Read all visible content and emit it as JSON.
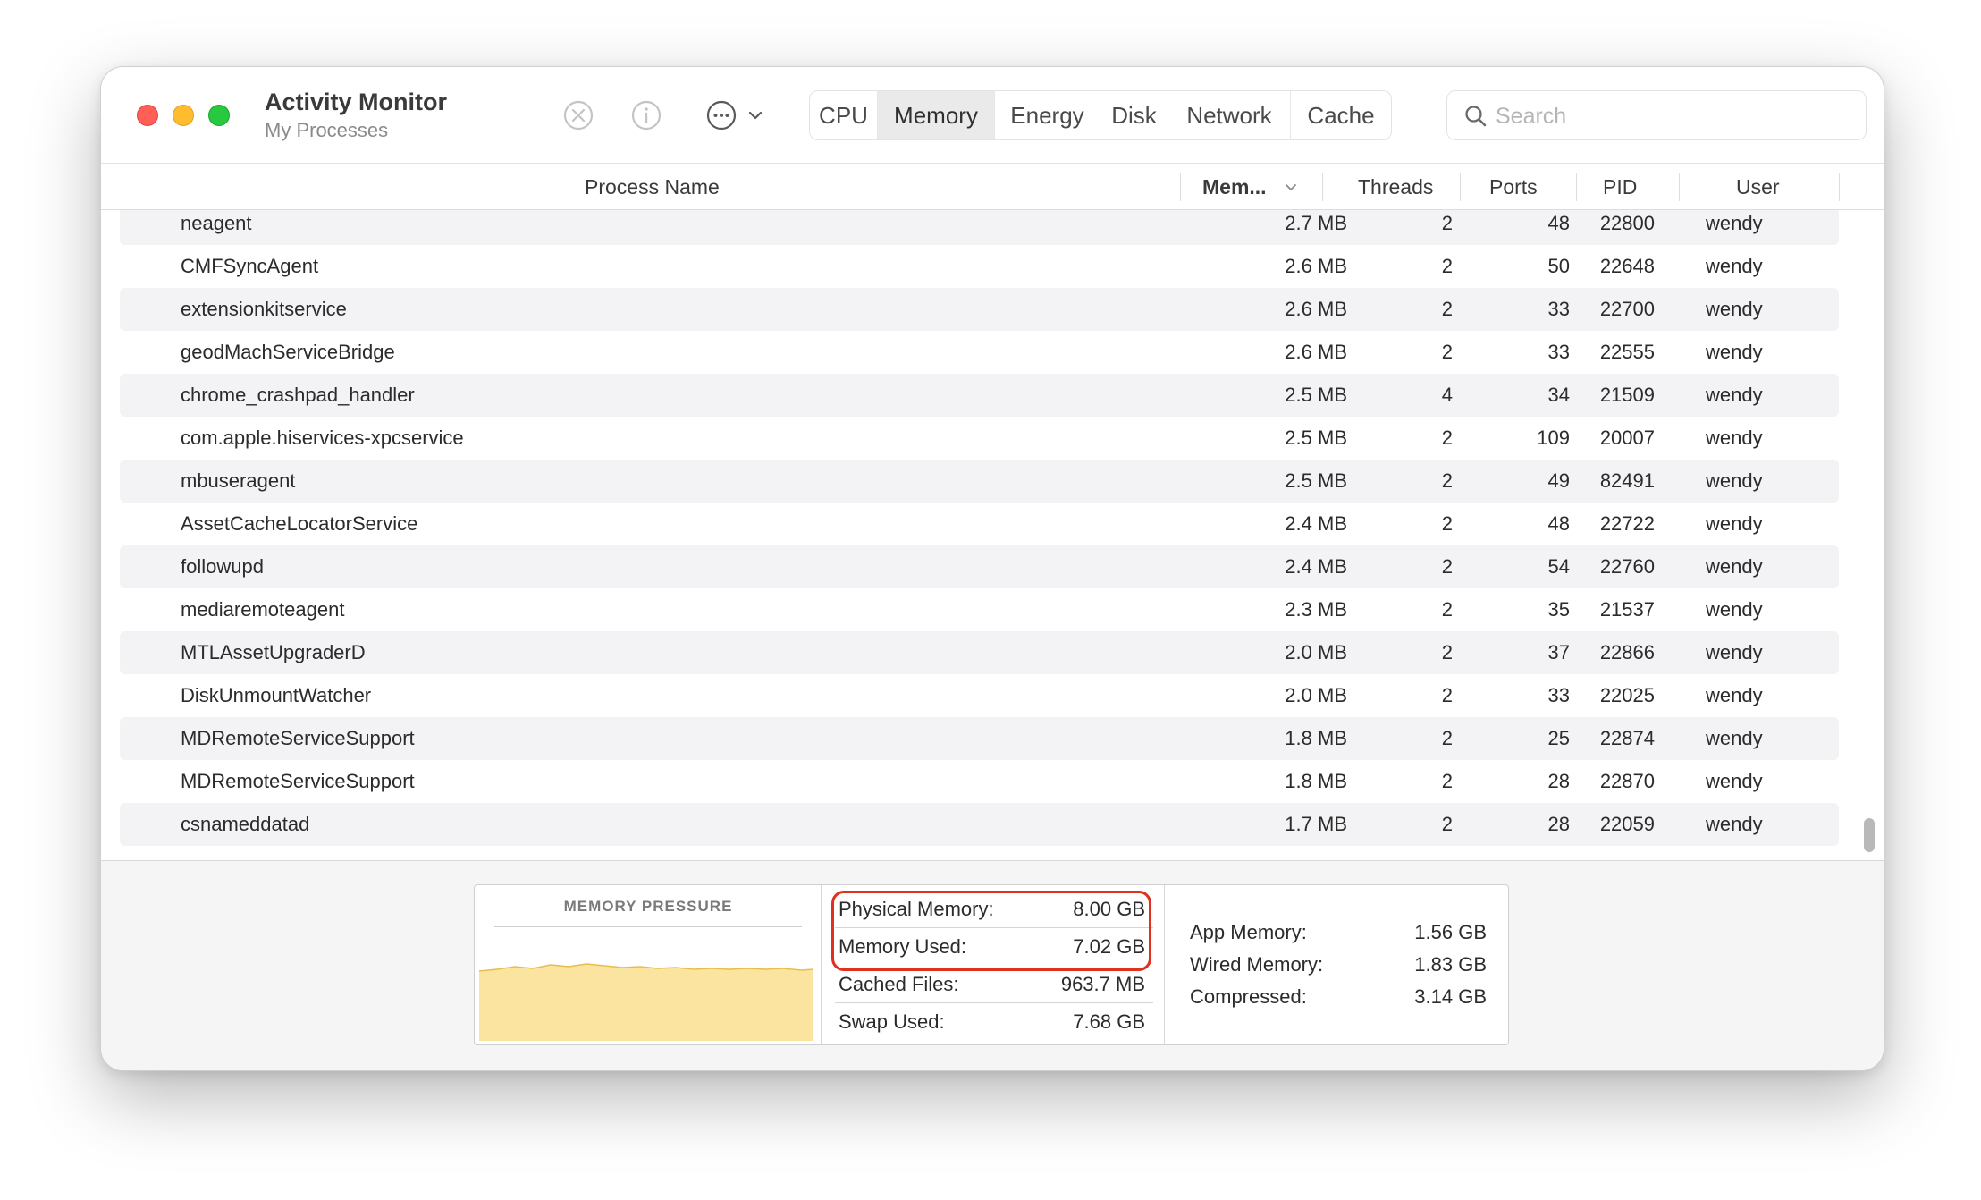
{
  "app": {
    "title": "Activity Monitor",
    "subtitle": "My Processes"
  },
  "toolbar": {
    "stop_icon": "x-circle-icon",
    "info_icon": "info-circle-icon",
    "more_icon": "ellipsis-circle-icon",
    "tabs": [
      {
        "label": "CPU",
        "active": false
      },
      {
        "label": "Memory",
        "active": true
      },
      {
        "label": "Energy",
        "active": false
      },
      {
        "label": "Disk",
        "active": false
      },
      {
        "label": "Network",
        "active": false
      },
      {
        "label": "Cache",
        "active": false
      }
    ],
    "search_placeholder": "Search"
  },
  "table": {
    "headers": {
      "name": "Process Name",
      "memory": "Mem...",
      "threads": "Threads",
      "ports": "Ports",
      "pid": "PID",
      "user": "User"
    },
    "rows": [
      {
        "name": "neagent",
        "memory": "2.7 MB",
        "threads": "2",
        "ports": "48",
        "pid": "22800",
        "user": "wendy"
      },
      {
        "name": "CMFSyncAgent",
        "memory": "2.6 MB",
        "threads": "2",
        "ports": "50",
        "pid": "22648",
        "user": "wendy"
      },
      {
        "name": "extensionkitservice",
        "memory": "2.6 MB",
        "threads": "2",
        "ports": "33",
        "pid": "22700",
        "user": "wendy"
      },
      {
        "name": "geodMachServiceBridge",
        "memory": "2.6 MB",
        "threads": "2",
        "ports": "33",
        "pid": "22555",
        "user": "wendy"
      },
      {
        "name": "chrome_crashpad_handler",
        "memory": "2.5 MB",
        "threads": "4",
        "ports": "34",
        "pid": "21509",
        "user": "wendy"
      },
      {
        "name": "com.apple.hiservices-xpcservice",
        "memory": "2.5 MB",
        "threads": "2",
        "ports": "109",
        "pid": "20007",
        "user": "wendy"
      },
      {
        "name": "mbuseragent",
        "memory": "2.5 MB",
        "threads": "2",
        "ports": "49",
        "pid": "82491",
        "user": "wendy"
      },
      {
        "name": "AssetCacheLocatorService",
        "memory": "2.4 MB",
        "threads": "2",
        "ports": "48",
        "pid": "22722",
        "user": "wendy"
      },
      {
        "name": "followupd",
        "memory": "2.4 MB",
        "threads": "2",
        "ports": "54",
        "pid": "22760",
        "user": "wendy"
      },
      {
        "name": "mediaremoteagent",
        "memory": "2.3 MB",
        "threads": "2",
        "ports": "35",
        "pid": "21537",
        "user": "wendy"
      },
      {
        "name": "MTLAssetUpgraderD",
        "memory": "2.0 MB",
        "threads": "2",
        "ports": "37",
        "pid": "22866",
        "user": "wendy"
      },
      {
        "name": "DiskUnmountWatcher",
        "memory": "2.0 MB",
        "threads": "2",
        "ports": "33",
        "pid": "22025",
        "user": "wendy"
      },
      {
        "name": "MDRemoteServiceSupport",
        "memory": "1.8 MB",
        "threads": "2",
        "ports": "25",
        "pid": "22874",
        "user": "wendy"
      },
      {
        "name": "MDRemoteServiceSupport",
        "memory": "1.8 MB",
        "threads": "2",
        "ports": "28",
        "pid": "22870",
        "user": "wendy"
      },
      {
        "name": "csnameddatad",
        "memory": "1.7 MB",
        "threads": "2",
        "ports": "28",
        "pid": "22059",
        "user": "wendy"
      }
    ]
  },
  "footer": {
    "pressure_title": "MEMORY PRESSURE",
    "physical_memory_label": "Physical Memory:",
    "physical_memory_value": "8.00 GB",
    "memory_used_label": "Memory Used:",
    "memory_used_value": "7.02 GB",
    "cached_files_label": "Cached Files:",
    "cached_files_value": "963.7 MB",
    "swap_used_label": "Swap Used:",
    "swap_used_value": "7.68 GB",
    "app_memory_label": "App Memory:",
    "app_memory_value": "1.56 GB",
    "wired_memory_label": "Wired Memory:",
    "wired_memory_value": "1.83 GB",
    "compressed_label": "Compressed:",
    "compressed_value": "3.14 GB"
  },
  "colors": {
    "pressure_fill": "#fbe4a0",
    "pressure_stroke": "#e8bd4c",
    "highlight": "#e0301e",
    "alt_row": "#f3f3f5"
  }
}
